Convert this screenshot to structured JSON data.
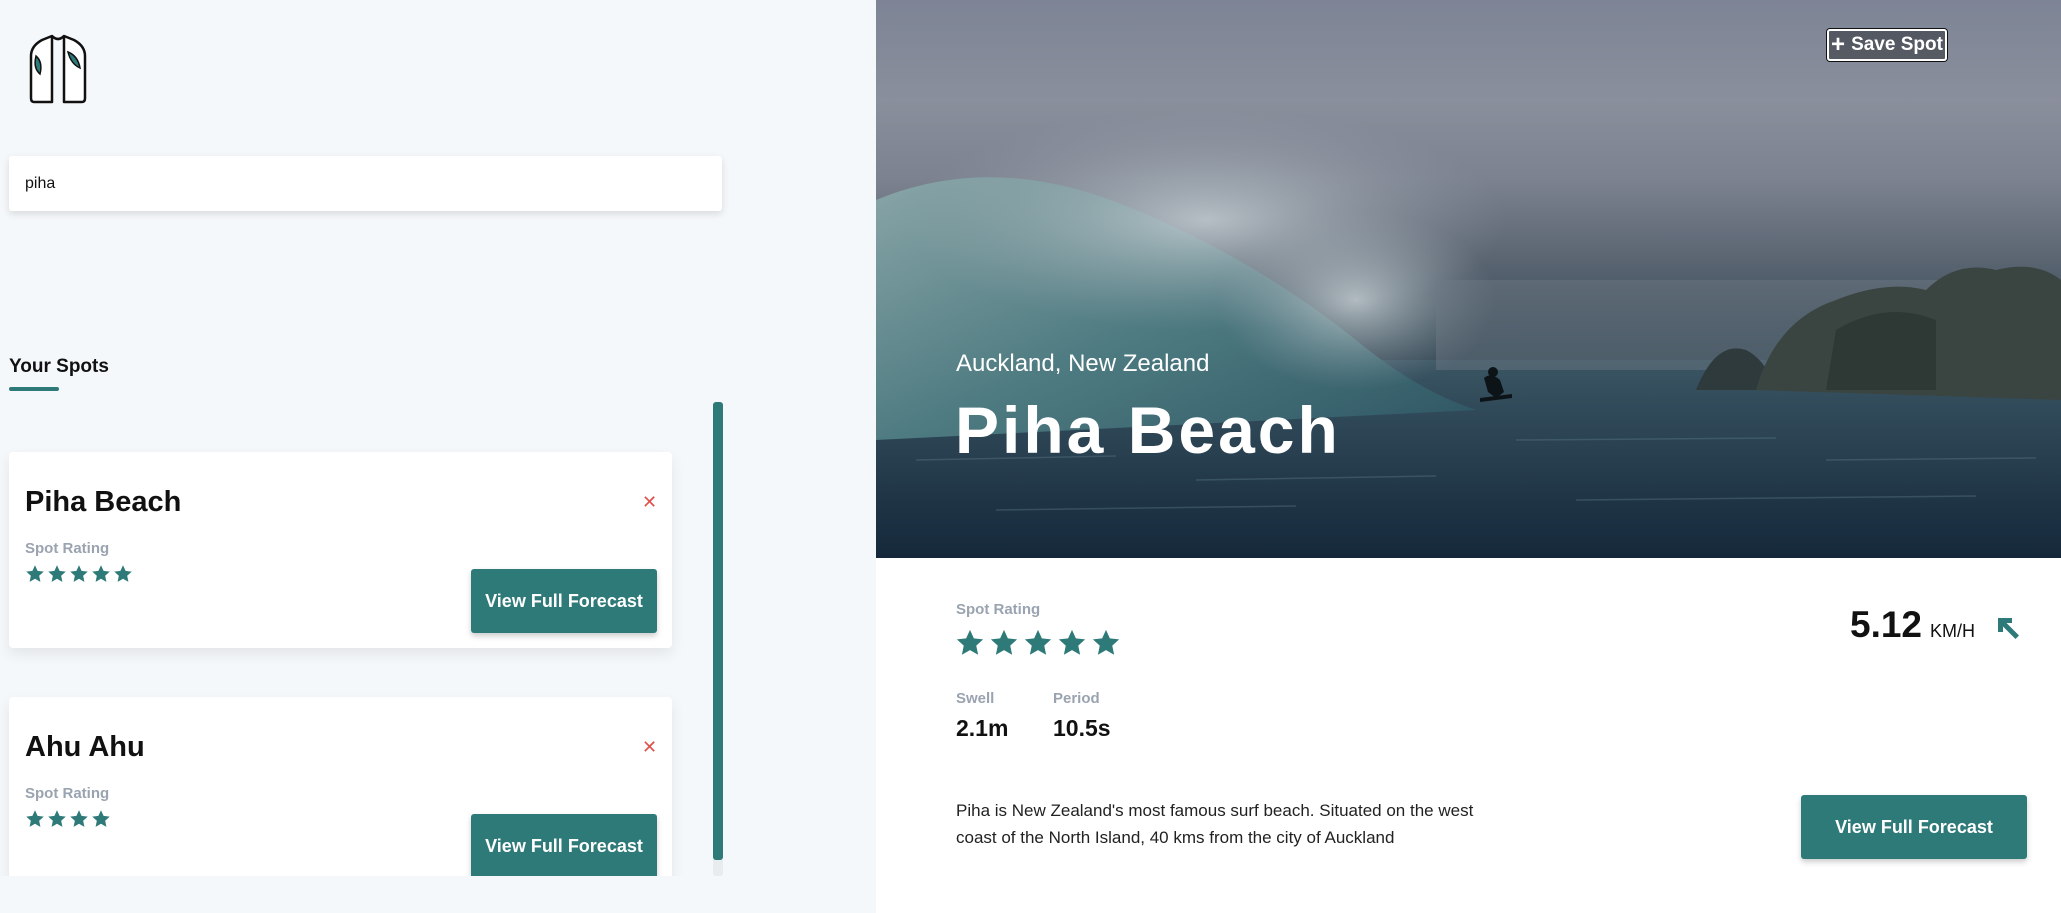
{
  "colors": {
    "accent": "#2e7a78",
    "close": "#e0524a",
    "muted_label": "#9aa3b0"
  },
  "search": {
    "value": "piha"
  },
  "sidebar": {
    "heading": "Your Spots",
    "spots": [
      {
        "name": "Piha Beach",
        "rating_label": "Spot Rating",
        "rating": 5,
        "button": "View Full Forecast",
        "remove_icon": "close-icon"
      },
      {
        "name": "Ahu Ahu",
        "rating_label": "Spot Rating",
        "rating": 4,
        "button": "View Full Forecast",
        "remove_icon": "close-icon"
      }
    ]
  },
  "hero": {
    "save_label": "Save Spot",
    "location": "Auckland, New Zealand",
    "title": "Piha Beach"
  },
  "detail": {
    "rating_label": "Spot Rating",
    "rating": 5,
    "wind_value": "5.12",
    "wind_unit": "KM/H",
    "wind_icon": "arrow-up-left-icon",
    "swell_label": "Swell",
    "swell_value": "2.1m",
    "period_label": "Period",
    "period_value": "10.5s",
    "description": "Piha is New Zealand's most famous surf beach. Situated on the west coast of the North Island, 40 kms from the city of Auckland",
    "button": "View Full Forecast"
  }
}
